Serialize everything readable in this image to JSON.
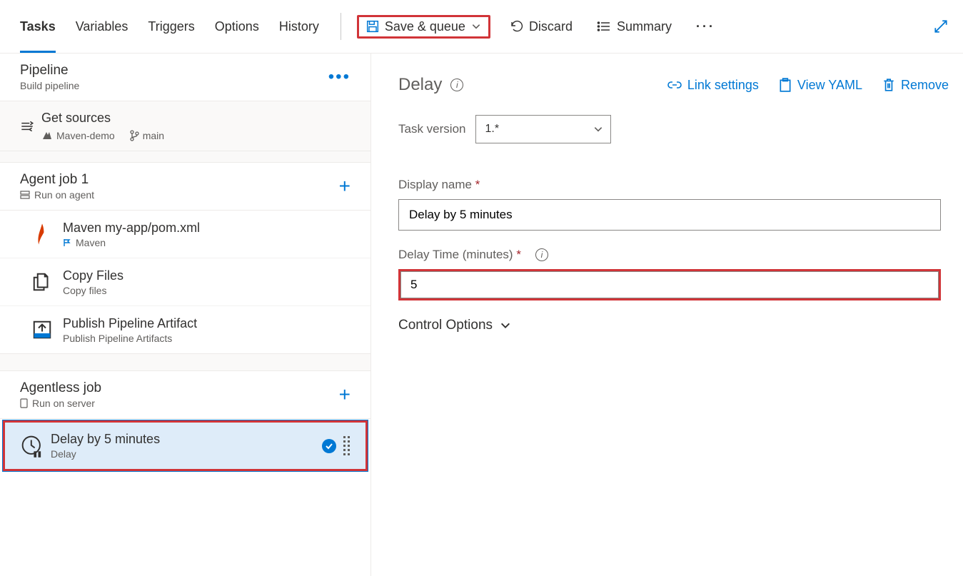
{
  "tabs": [
    "Tasks",
    "Variables",
    "Triggers",
    "Options",
    "History"
  ],
  "commands": {
    "save_queue": "Save & queue",
    "discard": "Discard",
    "summary": "Summary"
  },
  "left": {
    "pipeline_title": "Pipeline",
    "pipeline_sub": "Build pipeline",
    "sources_title": "Get sources",
    "repo": "Maven-demo",
    "branch": "main",
    "job1_title": "Agent job 1",
    "job1_sub": "Run on agent",
    "job2_title": "Agentless job",
    "job2_sub": "Run on server",
    "tasks": [
      {
        "name": "Maven my-app/pom.xml",
        "sub": "Maven"
      },
      {
        "name": "Copy Files",
        "sub": "Copy files"
      },
      {
        "name": "Publish Pipeline Artifact",
        "sub": "Publish Pipeline Artifacts"
      }
    ],
    "sel_task": {
      "name": "Delay by 5 minutes",
      "sub": "Delay"
    }
  },
  "right": {
    "title": "Delay",
    "link_settings": "Link settings",
    "view_yaml": "View YAML",
    "remove": "Remove",
    "task_version_label": "Task version",
    "task_version": "1.*",
    "display_name_label": "Display name",
    "display_name": "Delay by 5 minutes",
    "delay_time_label": "Delay Time (minutes)",
    "delay_time": "5",
    "control_options": "Control Options"
  }
}
